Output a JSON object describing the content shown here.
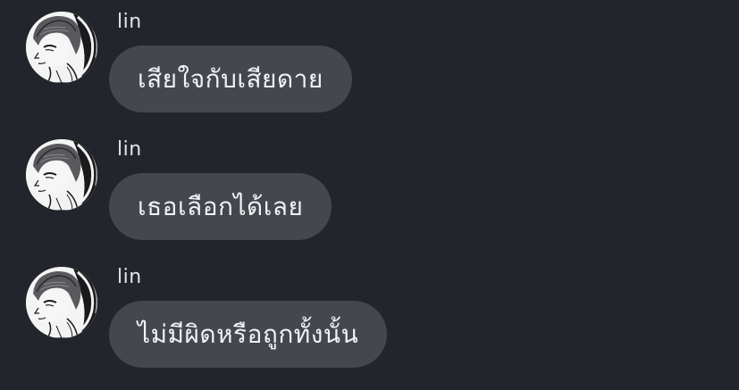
{
  "messages": [
    {
      "sender": "lin",
      "text": "เสียใจกับเสียดาย"
    },
    {
      "sender": "lin",
      "text": "เธอเลือกได้เลย"
    },
    {
      "sender": "lin",
      "text": "ไม่มีผิดหรือถูกทั้งนั้น"
    }
  ],
  "colors": {
    "background": "#23252d",
    "bubble": "#45474f",
    "text": "#f2f2f4",
    "sender": "#e3e4e8"
  },
  "icons": {
    "avatar": "user-avatar-manga-portrait"
  }
}
